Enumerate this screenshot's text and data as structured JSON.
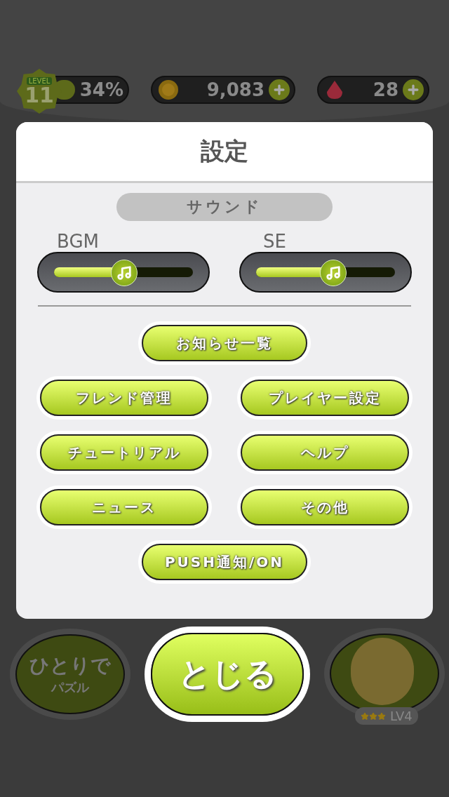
{
  "status": {
    "level_label": "LEVEL",
    "level": "11",
    "progress": "34%",
    "exp": {
      "level": 0.34
    },
    "coins": "9,083",
    "gems": "28"
  },
  "dialog": {
    "title": "設定",
    "section": "サウンド",
    "sliders": [
      {
        "label": "BGM",
        "level": 0.5
      },
      {
        "label": "SE",
        "level": 0.55
      }
    ],
    "buttons": [
      {
        "label": "お知らせ一覧",
        "wide": false
      },
      {
        "label": "フレンド管理",
        "wide": true
      },
      {
        "label": "プレイヤー設定",
        "wide": true
      },
      {
        "label": "チュートリアル",
        "wide": true
      },
      {
        "label": "ヘルプ",
        "wide": true
      },
      {
        "label": "ニュース",
        "wide": true
      },
      {
        "label": "その他",
        "wide": true
      },
      {
        "label": "PUSH通知/ON",
        "wide": false
      }
    ]
  },
  "bottom": {
    "solo": [
      "ひとりで",
      "パズル"
    ],
    "close": "とじる",
    "character": {
      "level": "LV4",
      "stars": 3
    }
  }
}
